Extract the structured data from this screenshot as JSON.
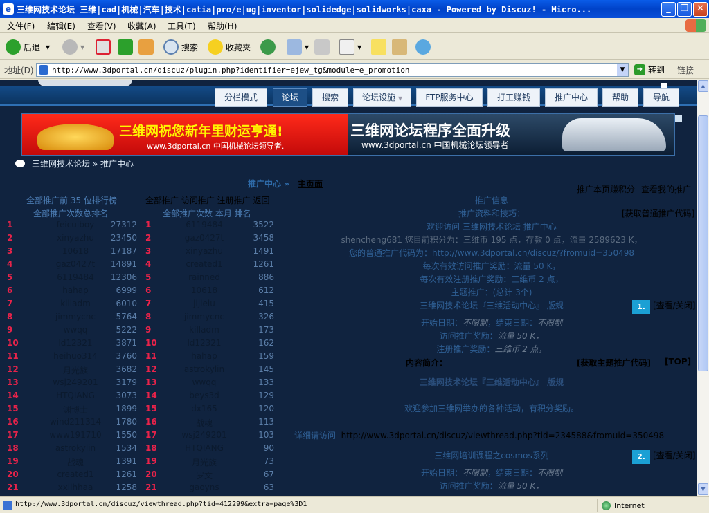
{
  "window": {
    "title": "三维网技术论坛 三维|cad|机械|汽车|技术|catia|pro/e|ug|inventor|solidedge|solidworks|caxa - Powered by Discuz! - Micro...",
    "min": "_",
    "max": "❐",
    "close": "✕"
  },
  "menu": [
    "文件(F)",
    "编辑(E)",
    "查看(V)",
    "收藏(A)",
    "工具(T)",
    "帮助(H)"
  ],
  "toolbar": {
    "back": "后退",
    "search": "搜索",
    "favorites": "收藏夹"
  },
  "address": {
    "label": "地址(D)",
    "url": "http://www.3dportal.cn/discuz/plugin.php?identifier=ejew_tg&module=e_promotion",
    "go": "转到",
    "links": "链接"
  },
  "nav": [
    "分栏模式",
    "论坛",
    "搜索",
    "论坛设施",
    "FTP服务中心",
    "打工赚钱",
    "推广中心",
    "帮助",
    "导航"
  ],
  "banner": {
    "left_title": "三维网祝您新年里财运亨通!",
    "left_sub": "www.3dportal.cn 中国机械论坛领导者.",
    "right_title": "三维网论坛程序全面升级",
    "right_sub": "www.3dportal.cn  中国机械论坛领导者"
  },
  "breadcrumb": {
    "home": "三维网技术论坛",
    "sep": "»",
    "current": "推广中心"
  },
  "center": {
    "title": "推广中心 »",
    "main": "主页面"
  },
  "right_header": {
    "points": "推广本页赚积分",
    "view": "查看我的推广"
  },
  "left_panel": {
    "header1": "全部推广前 35 位排行榜",
    "header2": "全部推广次数总排名"
  },
  "mid_panel": {
    "header1": "全部推广 访问推广 注册推广 返回",
    "header2": "全部推广次数 本月 排名"
  },
  "ranking_left": [
    {
      "rank": "1",
      "name": "feicuiboy",
      "score": "27312"
    },
    {
      "rank": "2",
      "name": "xinyazhu",
      "score": "23450"
    },
    {
      "rank": "3",
      "name": "10618",
      "score": "17187"
    },
    {
      "rank": "4",
      "name": "gaz0427t",
      "score": "14891"
    },
    {
      "rank": "5",
      "name": "6119484",
      "score": "12306"
    },
    {
      "rank": "6",
      "name": "hahap",
      "score": "6999"
    },
    {
      "rank": "7",
      "name": "killadm",
      "score": "6010"
    },
    {
      "rank": "8",
      "name": "jimmycnc",
      "score": "5764"
    },
    {
      "rank": "9",
      "name": "wwqq",
      "score": "5222"
    },
    {
      "rank": "10",
      "name": "ld12321",
      "score": "3871"
    },
    {
      "rank": "11",
      "name": "heihuo314",
      "score": "3760"
    },
    {
      "rank": "12",
      "name": "月光族",
      "score": "3682"
    },
    {
      "rank": "13",
      "name": "wsj249201",
      "score": "3179"
    },
    {
      "rank": "14",
      "name": "HTQIANG",
      "score": "3073"
    },
    {
      "rank": "15",
      "name": "渊博士",
      "score": "1899"
    },
    {
      "rank": "16",
      "name": "wind211314",
      "score": "1780"
    },
    {
      "rank": "17",
      "name": "www191710",
      "score": "1550"
    },
    {
      "rank": "18",
      "name": "astrokylin",
      "score": "1534"
    },
    {
      "rank": "19",
      "name": "战魂",
      "score": "1391"
    },
    {
      "rank": "20",
      "name": "created1",
      "score": "1261"
    },
    {
      "rank": "21",
      "name": "xxiihhaa",
      "score": "1258"
    }
  ],
  "ranking_mid": [
    {
      "rank": "1",
      "name": "6119484",
      "score": "3522"
    },
    {
      "rank": "2",
      "name": "gaz0427t",
      "score": "3458"
    },
    {
      "rank": "3",
      "name": "xinyazhu",
      "score": "1491"
    },
    {
      "rank": "4",
      "name": "created1",
      "score": "1261"
    },
    {
      "rank": "5",
      "name": "rainned",
      "score": "886"
    },
    {
      "rank": "6",
      "name": "10618",
      "score": "612"
    },
    {
      "rank": "7",
      "name": "jijieiu",
      "score": "415"
    },
    {
      "rank": "8",
      "name": "jimmycnc",
      "score": "326"
    },
    {
      "rank": "9",
      "name": "killadm",
      "score": "173"
    },
    {
      "rank": "10",
      "name": "ld12321",
      "score": "162"
    },
    {
      "rank": "11",
      "name": "hahap",
      "score": "159"
    },
    {
      "rank": "12",
      "name": "astrokylin",
      "score": "145"
    },
    {
      "rank": "13",
      "name": "wwqq",
      "score": "133"
    },
    {
      "rank": "14",
      "name": "beys3d",
      "score": "129"
    },
    {
      "rank": "15",
      "name": "dx165",
      "score": "120"
    },
    {
      "rank": "16",
      "name": "战魂",
      "score": "113"
    },
    {
      "rank": "17",
      "name": "wsj249201",
      "score": "103"
    },
    {
      "rank": "18",
      "name": "HTQIANG",
      "score": "90"
    },
    {
      "rank": "19",
      "name": "月光族",
      "score": "73"
    },
    {
      "rank": "20",
      "name": "罗文",
      "score": "67"
    },
    {
      "rank": "21",
      "name": "gaoyns",
      "score": "63"
    }
  ],
  "promo": {
    "info_title": "推广信息",
    "tips": "推广资料和技巧：",
    "get_code": "[获取普通推广代码]",
    "welcome": "欢迎访问 三维网技术论坛 推广中心",
    "user_status": "shencheng681 您目前积分为：三维币 195 点，存款 0 点，流量 2589623 K，",
    "code_line": "您的普通推广代码为：http://www.3dportal.cn/discuz/?fromuid=350498",
    "reward_visit": "每次有效访问推广奖励：流量 50 K，",
    "reward_reg": "每次有效注册推广奖励：三维币 2 点，",
    "topic_total": "主题推广：(总计 3个)",
    "topic1": "三维网技术论坛『三维活动中心』 版规",
    "badge1": "1.",
    "view_close": "[查看/关闭]",
    "date_prefix": "开始日期：",
    "unlimited": "不限制",
    "date_end": "，结束日期：",
    "visit_reward_label": "访问推广奖励：",
    "visit_reward_val": "流量 50 K，",
    "reg_reward_label": "注册推广奖励：",
    "reg_reward_val": "三维币 2 点，",
    "intro": "内容简介：",
    "topic_code": "[获取主题推广代码]",
    "top": "[TOP]",
    "topic1_bold": "三维网技术论坛『三维活动中心』 版规",
    "welcome_event": "欢迎参加三维网举办的各种活动，有积分奖励。",
    "detail_label": "详细请访问",
    "detail_url": "http://www.3dportal.cn/discuz/viewthread.php?tid=234588&fromuid=350498",
    "topic2": "三维网培训课程之cosmos系列",
    "badge2": "2."
  },
  "status": {
    "url": "http://www.3dportal.cn/discuz/viewthread.php?tid=412299&extra=page%3D1",
    "zone": "Internet"
  }
}
